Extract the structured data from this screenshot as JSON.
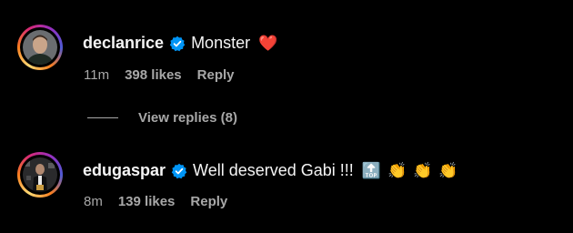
{
  "comments": [
    {
      "username": "declanrice",
      "text": "Monster",
      "emojis": [
        "❤️"
      ],
      "time": "11m",
      "likes": "398 likes",
      "reply": "Reply"
    },
    {
      "username": "edugaspar",
      "text": "Well deserved Gabi !!!",
      "emojis": [
        "🔝",
        "👏",
        "👏",
        "👏"
      ],
      "time": "8m",
      "likes": "139 likes",
      "reply": "Reply"
    }
  ],
  "view_replies": "View replies (8)",
  "colors": {
    "background": "#000000",
    "primary_text": "#f5f5f5",
    "secondary_text": "#a8a8a8",
    "verified": "#0095f6",
    "heart": "#ff3040"
  }
}
